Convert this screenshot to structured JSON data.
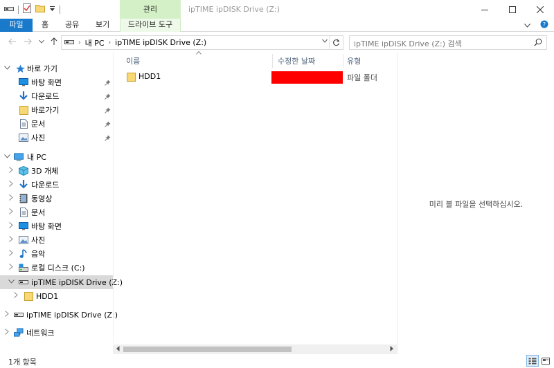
{
  "window": {
    "title": "ipTIME ipDISK Drive (Z:)",
    "manage_tab": "관리",
    "minimize": "—",
    "maximize": "☐",
    "close": "✕"
  },
  "ribbon": {
    "tabs": [
      {
        "label": "파일"
      },
      {
        "label": "홈"
      },
      {
        "label": "공유"
      },
      {
        "label": "보기"
      },
      {
        "label": "드라이브 도구"
      }
    ],
    "help": "?"
  },
  "address": {
    "crumbs": [
      "내 PC",
      "ipTIME ipDISK Drive (Z:)"
    ],
    "search_placeholder": "ipTIME ipDISK Drive (Z:) 검색"
  },
  "sidebar": {
    "items": [
      {
        "label": "바로 가기",
        "icon": "star-icon",
        "exp": "v",
        "pinned": false
      },
      {
        "label": "바탕 화면",
        "icon": "desktop-icon",
        "pinned": true
      },
      {
        "label": "다운로드",
        "icon": "download-icon",
        "pinned": true
      },
      {
        "label": "바로가기",
        "icon": "folder-icon",
        "pinned": true
      },
      {
        "label": "문서",
        "icon": "document-icon",
        "pinned": true
      },
      {
        "label": "사진",
        "icon": "pictures-icon",
        "pinned": true
      },
      {
        "label": "내 PC",
        "icon": "pc-icon",
        "exp": "v",
        "pinned": false
      },
      {
        "label": "3D 개체",
        "icon": "cube-icon",
        "exp": ">"
      },
      {
        "label": "다운로드",
        "icon": "download-icon",
        "exp": ">"
      },
      {
        "label": "동영상",
        "icon": "video-icon",
        "exp": ">"
      },
      {
        "label": "문서",
        "icon": "document-icon",
        "exp": ">"
      },
      {
        "label": "바탕 화면",
        "icon": "desktop-icon",
        "exp": ">"
      },
      {
        "label": "사진",
        "icon": "pictures-icon",
        "exp": ">"
      },
      {
        "label": "음악",
        "icon": "music-icon",
        "exp": ">"
      },
      {
        "label": "로컬 디스크 (C:)",
        "icon": "disk-icon",
        "exp": ">"
      },
      {
        "label": "ipTIME ipDISK Drive (Z:)",
        "icon": "drive-icon",
        "exp": "v",
        "selected": true
      },
      {
        "label": "HDD1",
        "icon": "folder-icon",
        "exp": ">"
      },
      {
        "label": "ipTIME ipDISK Drive (Z:)",
        "icon": "drive-icon",
        "exp": ">"
      },
      {
        "label": "네트워크",
        "icon": "network-icon",
        "exp": ">"
      }
    ]
  },
  "filelist": {
    "columns": [
      "이름",
      "수정한 날짜",
      "유형"
    ],
    "rows": [
      {
        "name": "HDD1",
        "type": "파일 폴더",
        "redact_color": "#ff0000"
      }
    ]
  },
  "preview": {
    "message": "미리 볼 파일을 선택하십시오."
  },
  "status": {
    "count": "1개 항목"
  },
  "colors": {
    "accent": "#1979ca",
    "manage": "#d3f0c6",
    "folder": "#f8d775",
    "selected": "#d9d9d9"
  }
}
